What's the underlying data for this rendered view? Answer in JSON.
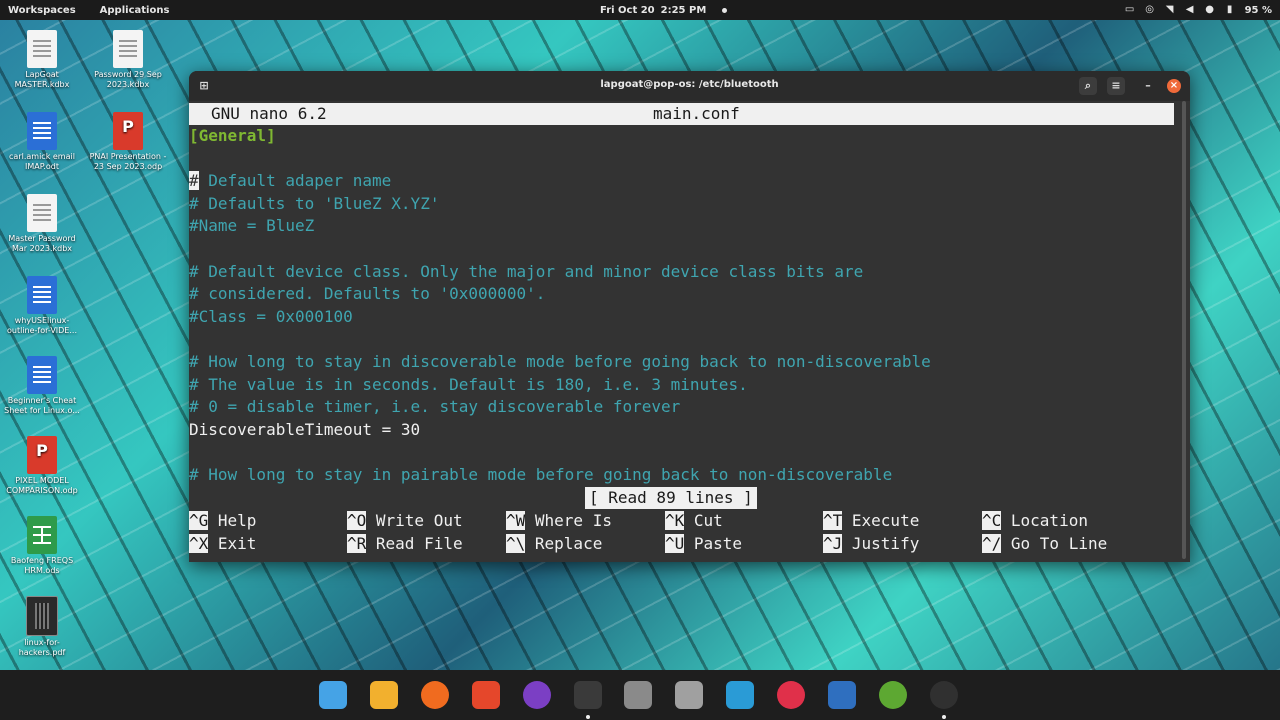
{
  "topbar": {
    "workspaces": "Workspaces",
    "applications": "Applications",
    "date": "Fri Oct 20",
    "time": "2:25 PM",
    "battery": "95 %"
  },
  "desktop_icons": [
    {
      "label": "LapGoat MASTER.kdbx",
      "kind": "doc-white"
    },
    {
      "label": "Password 29 Sep 2023.kdbx",
      "kind": "doc-white"
    },
    {
      "label": "carl.amick email IMAP.odt",
      "kind": "doc-blue"
    },
    {
      "label": "PNAI Presentation - 23 Sep 2023.odp",
      "kind": "doc-red"
    },
    {
      "label": "Master Password Mar 2023.kdbx",
      "kind": "doc-white"
    },
    {
      "label": "whyUSElinux-outline-for-VIDE...",
      "kind": "doc-blue"
    },
    {
      "label": "Beginner's Cheat Sheet for Linux.o...",
      "kind": "doc-blue"
    },
    {
      "label": "PIXEL MODEL COMPARISON.odp",
      "kind": "doc-red"
    },
    {
      "label": "Baofeng FREQS HRM.ods",
      "kind": "doc-green"
    },
    {
      "label": "linux-for-hackers.pdf",
      "kind": "doc-dark"
    }
  ],
  "window": {
    "title": "lapgoat@pop-os: /etc/bluetooth"
  },
  "nano": {
    "version": "GNU nano 6.2",
    "filename": "main.conf",
    "lines": [
      {
        "text": "[General]",
        "style": "section"
      },
      {
        "text": "",
        "style": "plain"
      },
      {
        "text": " Default adaper name",
        "style": "comment",
        "cursor": "#"
      },
      {
        "text": "# Defaults to 'BlueZ X.YZ'",
        "style": "comment"
      },
      {
        "text": "#Name = BlueZ",
        "style": "comment"
      },
      {
        "text": "",
        "style": "plain"
      },
      {
        "text": "# Default device class. Only the major and minor device class bits are",
        "style": "comment"
      },
      {
        "text": "# considered. Defaults to '0x000000'.",
        "style": "comment"
      },
      {
        "text": "#Class = 0x000100",
        "style": "comment"
      },
      {
        "text": "",
        "style": "plain"
      },
      {
        "text": "# How long to stay in discoverable mode before going back to non-discoverable",
        "style": "comment"
      },
      {
        "text": "# The value is in seconds. Default is 180, i.e. 3 minutes.",
        "style": "comment"
      },
      {
        "text": "# 0 = disable timer, i.e. stay discoverable forever",
        "style": "comment"
      },
      {
        "text": "DiscoverableTimeout = 30",
        "style": "plain"
      },
      {
        "text": "",
        "style": "plain"
      },
      {
        "text": "# How long to stay in pairable mode before going back to non-discoverable",
        "style": "comment"
      }
    ],
    "status": "[ Read 89 lines ]",
    "shortcuts": [
      {
        "key": "^G",
        "label": "Help"
      },
      {
        "key": "^O",
        "label": "Write Out"
      },
      {
        "key": "^W",
        "label": "Where Is"
      },
      {
        "key": "^K",
        "label": "Cut"
      },
      {
        "key": "^T",
        "label": "Execute"
      },
      {
        "key": "^C",
        "label": "Location"
      },
      {
        "key": "^X",
        "label": "Exit"
      },
      {
        "key": "^R",
        "label": "Read File"
      },
      {
        "key": "^\\",
        "label": "Replace"
      },
      {
        "key": "^U",
        "label": "Paste"
      },
      {
        "key": "^J",
        "label": "Justify"
      },
      {
        "key": "^/",
        "label": "Go To Line"
      }
    ]
  },
  "dock": [
    {
      "name": "file-manager-store-icon",
      "color": "#45a3e6"
    },
    {
      "name": "app-grid-icon",
      "color": "#f2b02e"
    },
    {
      "name": "firefox-icon",
      "color": "#f06b1f"
    },
    {
      "name": "brave-icon",
      "color": "#e5472b"
    },
    {
      "name": "tor-browser-icon",
      "color": "#7b3fc4"
    },
    {
      "name": "terminal-icon",
      "color": "#3a3a3a",
      "active": true
    },
    {
      "name": "files-icon",
      "color": "#8a8a8a"
    },
    {
      "name": "settings-icon",
      "color": "#a0a0a0"
    },
    {
      "name": "veracrypt-icon",
      "color": "#2a9bd6"
    },
    {
      "name": "creative-cloud-icon",
      "color": "#e0304a"
    },
    {
      "name": "virtualbox-icon",
      "color": "#2f6fbf"
    },
    {
      "name": "keepassxc-icon",
      "color": "#5da832"
    },
    {
      "name": "obs-icon",
      "color": "#303030",
      "active": true
    }
  ]
}
